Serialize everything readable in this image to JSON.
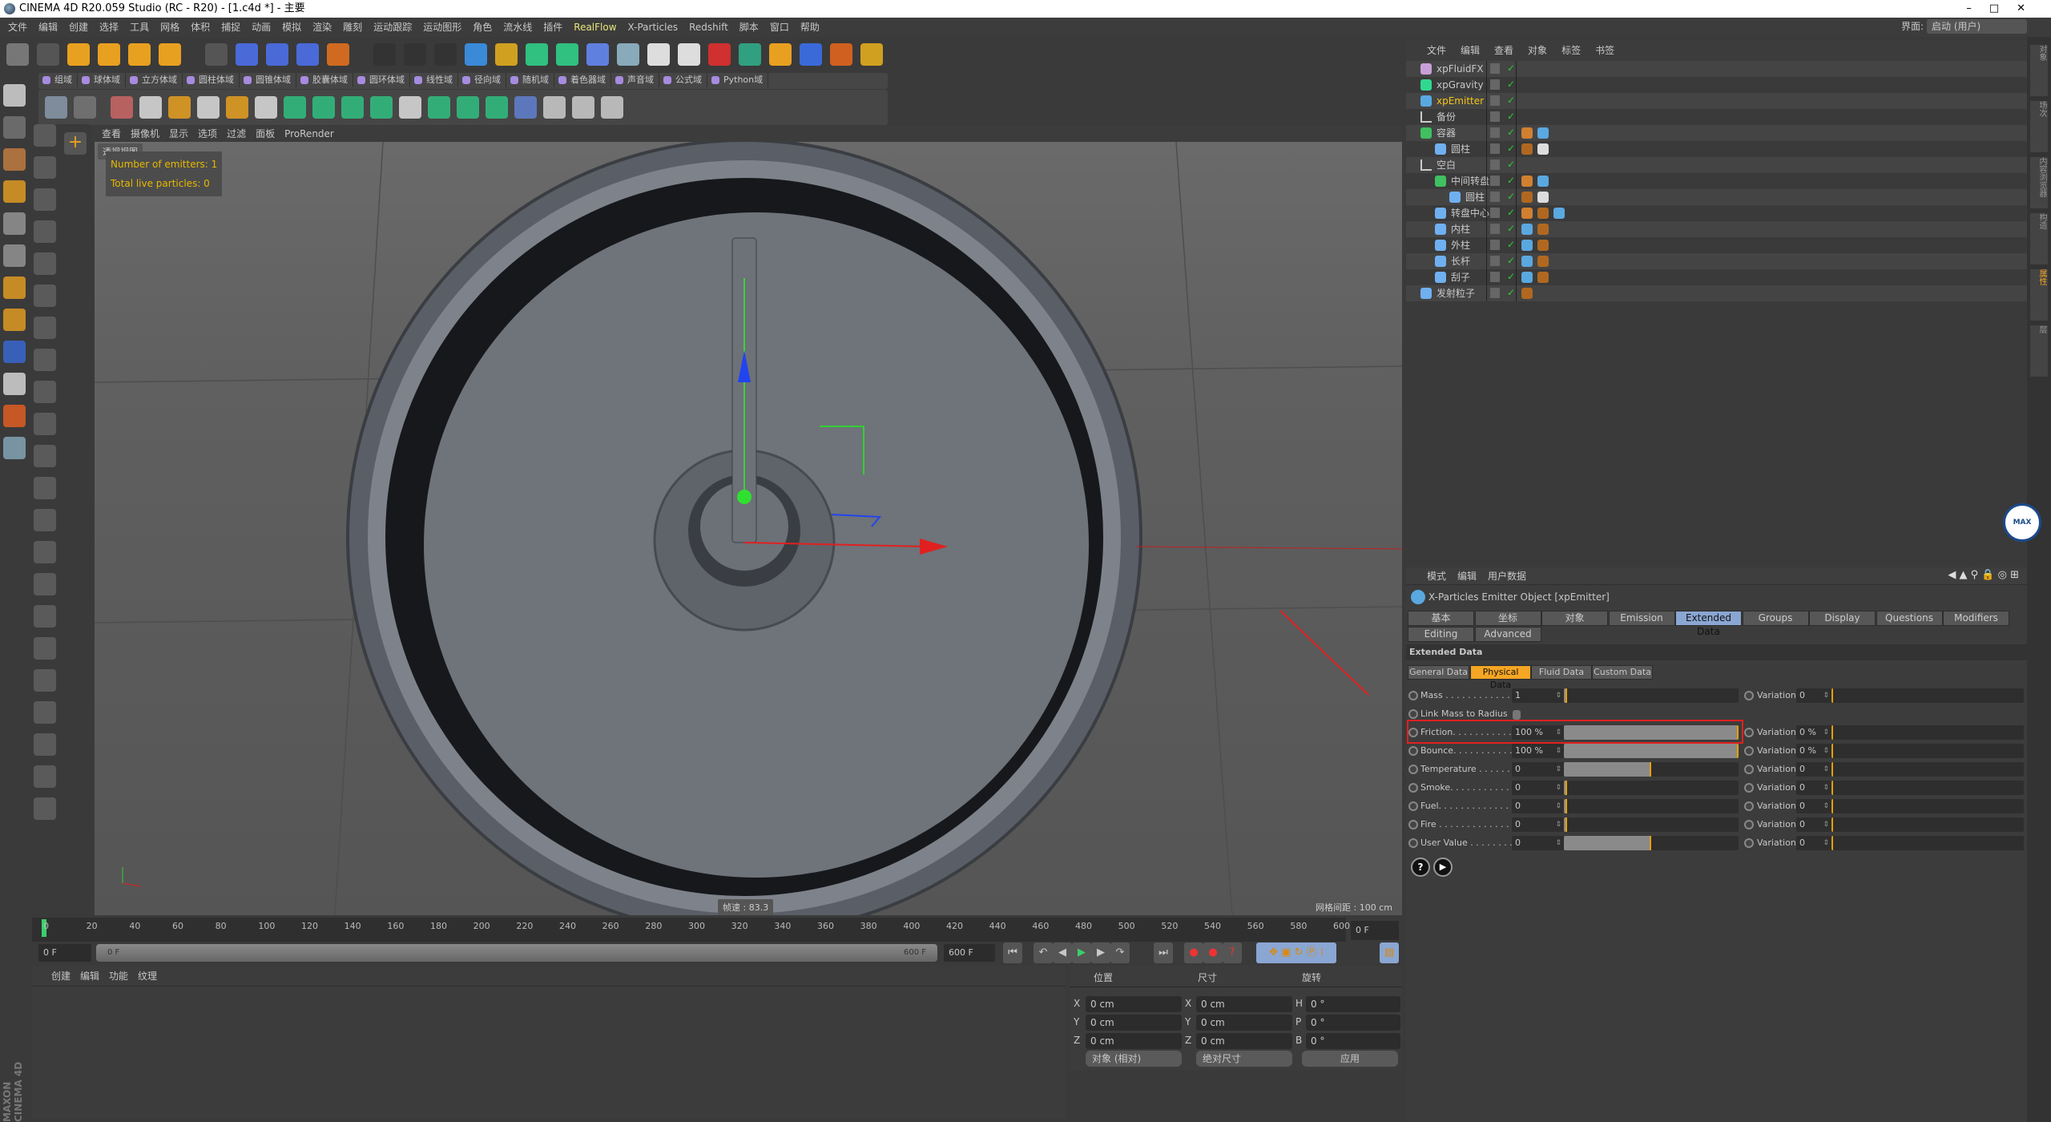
{
  "window": {
    "title": "CINEMA 4D R20.059 Studio (RC - R20) - [1.c4d *] - 主要",
    "controls": "–□✕"
  },
  "menu": [
    "文件",
    "编辑",
    "创建",
    "选择",
    "工具",
    "网格",
    "体积",
    "捕捉",
    "动画",
    "模拟",
    "渲染",
    "雕刻",
    "运动跟踪",
    "运动图形",
    "角色",
    "流水线",
    "插件",
    "RealFlow",
    "X-Particles",
    "Redshift",
    "脚本",
    "窗口",
    "帮助"
  ],
  "menu_highlight": "RealFlow",
  "layout": {
    "label": "界面:",
    "value": "启动 (用户)"
  },
  "fields_toolbar": [
    "组域",
    "球体域",
    "立方体域",
    "圆柱体域",
    "圆锥体域",
    "胶囊体域",
    "圆环体域",
    "线性域",
    "径向域",
    "随机域",
    "着色器域",
    "声音域",
    "公式域",
    "Python域"
  ],
  "viewport": {
    "menu": [
      "查看",
      "摄像机",
      "显示",
      "选项",
      "过滤",
      "面板",
      "ProRender"
    ],
    "view_name": "透视视图",
    "hud": [
      "Number of emitters: 1",
      "Total live particles: 0"
    ],
    "fps": "帧速 : 83.3",
    "grid": "网格间距 : 100 cm"
  },
  "timeline": {
    "ticks": [
      0,
      20,
      40,
      60,
      80,
      100,
      120,
      140,
      160,
      180,
      200,
      220,
      240,
      260,
      280,
      300,
      320,
      340,
      360,
      380,
      400,
      420,
      440,
      460,
      480,
      500,
      520,
      540,
      560,
      580,
      600
    ],
    "current": "0 F",
    "start": "0 F",
    "range_start": "0 F",
    "range_end": "600 F",
    "end": "600 F"
  },
  "material_manager": {
    "menu": [
      "创建",
      "编辑",
      "功能",
      "纹理"
    ]
  },
  "coordinates": {
    "headers": [
      "位置",
      "尺寸",
      "旋转"
    ],
    "rows": [
      {
        "a": "X",
        "pos": "0 cm",
        "b": "X",
        "size": "0 cm",
        "c": "H",
        "rot": "0 °"
      },
      {
        "a": "Y",
        "pos": "0 cm",
        "b": "Y",
        "size": "0 cm",
        "c": "P",
        "rot": "0 °"
      },
      {
        "a": "Z",
        "pos": "0 cm",
        "b": "Z",
        "size": "0 cm",
        "c": "B",
        "rot": "0 °"
      }
    ],
    "mode": "对象 (相对)",
    "size_mode": "绝对尺寸",
    "apply": "应用"
  },
  "brand": "MAXON CINEMA 4D",
  "object_manager": {
    "menu": [
      "文件",
      "编辑",
      "查看",
      "对象",
      "标签",
      "书签"
    ],
    "objects": [
      {
        "name": "xpFluidFX",
        "level": 0,
        "icon": "#c8a0d8",
        "tags": []
      },
      {
        "name": "xpGravity",
        "level": 0,
        "icon": "#30d890",
        "tags": []
      },
      {
        "name": "xpEmitter",
        "level": 0,
        "icon": "#5aa8e0",
        "selected": true,
        "tags": []
      },
      {
        "name": "备份",
        "level": 0,
        "icon": "null",
        "tags": []
      },
      {
        "name": "容器",
        "level": 0,
        "icon": "#40c060",
        "tags": [
          "#d08030",
          "#5aa8e0"
        ]
      },
      {
        "name": "圆柱",
        "level": 1,
        "icon": "#70b0f0",
        "tags": [
          "#b06820",
          "#ddd"
        ]
      },
      {
        "name": "空白",
        "level": 0,
        "icon": "null",
        "tags": []
      },
      {
        "name": "中间转盘",
        "level": 1,
        "icon": "#40c060",
        "tags": [
          "#d08030",
          "#5aa8e0"
        ]
      },
      {
        "name": "圆柱",
        "level": 2,
        "icon": "#70b0f0",
        "tags": [
          "#b06820",
          "#ddd"
        ]
      },
      {
        "name": "转盘中心",
        "level": 1,
        "icon": "#70b0f0",
        "tags": [
          "#d08030",
          "#b06820",
          "#5aa8e0"
        ]
      },
      {
        "name": "内柱",
        "level": 1,
        "icon": "#70b0f0",
        "tags": [
          "#5aa8e0",
          "#b06820"
        ]
      },
      {
        "name": "外柱",
        "level": 1,
        "icon": "#70b0f0",
        "tags": [
          "#5aa8e0",
          "#b06820"
        ]
      },
      {
        "name": "长杆",
        "level": 1,
        "icon": "#70b0f0",
        "tags": [
          "#5aa8e0",
          "#b06820"
        ]
      },
      {
        "name": "刮子",
        "level": 1,
        "icon": "#70b0f0",
        "tags": [
          "#5aa8e0",
          "#b06820"
        ]
      },
      {
        "name": "发射粒子",
        "level": 0,
        "icon": "#70b0f0",
        "tags": [
          "#b06820"
        ]
      }
    ]
  },
  "attributes": {
    "menu": [
      "模式",
      "编辑",
      "用户数据"
    ],
    "title": "X-Particles Emitter Object [xpEmitter]",
    "tabs": [
      "基本",
      "坐标",
      "对象",
      "Emission",
      "Extended Data",
      "Groups",
      "Display",
      "Questions",
      "Modifiers",
      "Editing",
      "Advanced"
    ],
    "active_tab": "Extended Data",
    "section": "Extended Data",
    "subtabs": [
      "General Data",
      "Physical Data",
      "Fluid Data",
      "Custom Data"
    ],
    "active_subtab": "Physical Data",
    "link_mass": "Link Mass to Radius",
    "params": [
      {
        "label": "Mass . . . . . . . . . . . . .",
        "value": "1",
        "fill": 0.01,
        "var_label": "Variation",
        "var": "0"
      },
      {
        "label": "Friction. . . . . . . . . . .",
        "value": "100 %",
        "fill": 1.0,
        "var_label": "Variation",
        "var": "0 %",
        "highlighted": true
      },
      {
        "label": "Bounce. . . . . . . . . . .",
        "value": "100 %",
        "fill": 1.0,
        "var_label": "Variation",
        "var": "0 %"
      },
      {
        "label": "Temperature . . . . . .",
        "value": "0",
        "fill": 0.5,
        "var_label": "Variation",
        "var": "0"
      },
      {
        "label": "Smoke. . . . . . . . . . . .",
        "value": "0",
        "fill": 0,
        "var_label": "Variation",
        "var": "0"
      },
      {
        "label": "Fuel. . . . . . . . . . . . . .",
        "value": "0",
        "fill": 0,
        "var_label": "Variation",
        "var": "0"
      },
      {
        "label": "Fire . . . . . . . . . . . . . .",
        "value": "0",
        "fill": 0,
        "var_label": "Variation",
        "var": "0"
      },
      {
        "label": "User Value . . . . . . . .",
        "value": "0",
        "fill": 0.5,
        "var_label": "Variation",
        "var": "0"
      }
    ]
  },
  "side_tabs": [
    "对象",
    "场次",
    "内容浏览器",
    "构造",
    "属性",
    "层"
  ],
  "colors": {
    "accent": "#f5a623",
    "active_tab": "#8aa6d2",
    "highlight_box": "#e02020",
    "selected_object": "#f5c518"
  }
}
